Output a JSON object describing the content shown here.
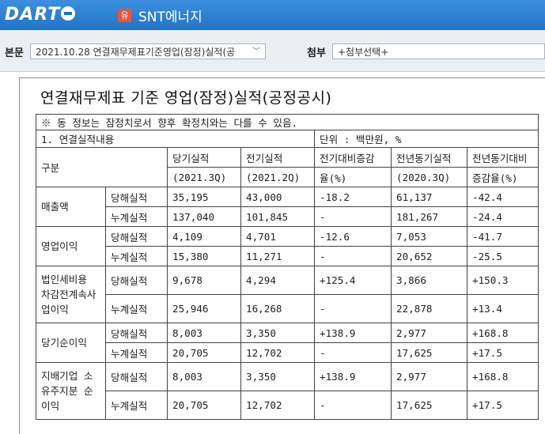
{
  "header": {
    "logo_text": "DART",
    "corp_badge": "유",
    "corp_name": "SNT에너지",
    "bar_color": "#2274c4"
  },
  "toolbar": {
    "main_label": "본문",
    "main_select_value": "2021.10.28  연결재무제표기준영업(잠정)실적(공",
    "attach_label": "첨부",
    "attach_select_value": "+첨부선택+"
  },
  "document": {
    "title": "연결재무제표 기준 영업(잠정)실적(공정공시)",
    "notice": "※ 동 정보는 잠정치로서 향후 확정치와는 다를 수 있음.",
    "section": "1. 연결실적내용",
    "unit": "단위 : 백만원, %",
    "col_header_1": "구분",
    "col_current_title": "당기실적",
    "col_current_period": "(2021.3Q)",
    "col_prev_title": "전기실적",
    "col_prev_period": "(2021.2Q)",
    "col_qoq_title": "전기대비증감",
    "col_qoq_unit": "율(%)",
    "col_yoy_title": "전년동기실적",
    "col_yoy_period": "(2020.3Q)",
    "col_yoyr_title": "전년동기대비",
    "col_yoyr_unit": "증감율(%)",
    "rows": [
      {
        "category": "매출액",
        "sub": "당해실적",
        "current": "35,195",
        "prev": "43,000",
        "qoq": "-18.2",
        "yoy": "61,137",
        "yoy_rate": "-42.4"
      },
      {
        "category": "",
        "sub": "누계실적",
        "current": "137,040",
        "prev": "101,845",
        "qoq": "-",
        "yoy": "181,267",
        "yoy_rate": "-24.4"
      },
      {
        "category": "영업이익",
        "sub": "당해실적",
        "current": "4,109",
        "prev": "4,701",
        "qoq": "-12.6",
        "yoy": "7,053",
        "yoy_rate": "-41.7"
      },
      {
        "category": "",
        "sub": "누계실적",
        "current": "15,380",
        "prev": "11,271",
        "qoq": "-",
        "yoy": "20,652",
        "yoy_rate": "-25.5"
      },
      {
        "category": "법인세비용\n차감전계속사\n업이익",
        "sub": "당해실적",
        "current": "9,678",
        "prev": "4,294",
        "qoq": "+125.4",
        "yoy": "3,866",
        "yoy_rate": "+150.3"
      },
      {
        "category": "",
        "sub": "누계실적",
        "current": "25,946",
        "prev": "16,268",
        "qoq": "-",
        "yoy": "22,878",
        "yoy_rate": "+13.4"
      },
      {
        "category": "당기순이익",
        "sub": "당해실적",
        "current": "8,003",
        "prev": "3,350",
        "qoq": "+138.9",
        "yoy": "2,977",
        "yoy_rate": "+168.8"
      },
      {
        "category": "",
        "sub": "누계실적",
        "current": "20,705",
        "prev": "12,702",
        "qoq": "-",
        "yoy": "17,625",
        "yoy_rate": "+17.5"
      },
      {
        "category": "지배기업 소\n유주지분 순\n이익",
        "sub": "당해실적",
        "current": "8,003",
        "prev": "3,350",
        "qoq": "+138.9",
        "yoy": "2,977",
        "yoy_rate": "+168.8"
      },
      {
        "category": "",
        "sub": "누계실적",
        "current": "20,705",
        "prev": "12,702",
        "qoq": "-",
        "yoy": "17,625",
        "yoy_rate": "+17.5"
      }
    ]
  }
}
